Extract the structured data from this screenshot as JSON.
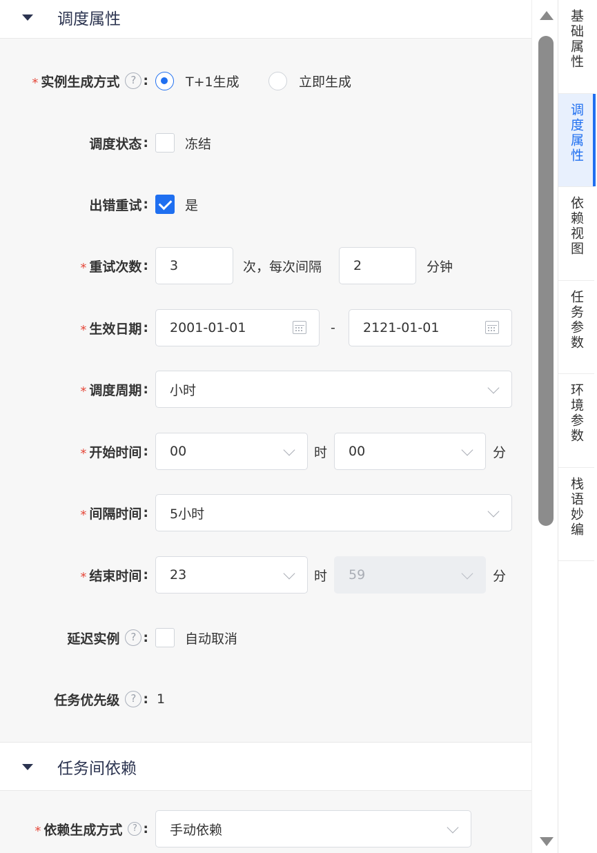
{
  "sections": {
    "schedule_title": "调度属性",
    "dependency_title": "任务间依赖"
  },
  "form": {
    "instance_generation": {
      "label": "实例生成方式",
      "options": [
        "T+1生成",
        "立即生成"
      ],
      "selected": "T+1生成"
    },
    "schedule_status": {
      "label": "调度状态",
      "option": "冻结",
      "checked": false
    },
    "retry_on_error": {
      "label": "出错重试",
      "option": "是",
      "checked": true
    },
    "retry_count": {
      "label": "重试次数",
      "count": "3",
      "middle_text": "次，每次间隔",
      "interval": "2",
      "unit": "分钟"
    },
    "effective_date": {
      "label": "生效日期",
      "start": "2001-01-01",
      "separator": "-",
      "end": "2121-01-01"
    },
    "schedule_period": {
      "label": "调度周期",
      "value": "小时"
    },
    "start_time": {
      "label": "开始时间",
      "hour": "00",
      "hour_unit": "时",
      "minute": "00",
      "minute_unit": "分"
    },
    "interval_time": {
      "label": "间隔时间",
      "value": "5小时"
    },
    "end_time": {
      "label": "结束时间",
      "hour": "23",
      "hour_unit": "时",
      "minute": "59",
      "minute_unit": "分"
    },
    "delay_instance": {
      "label": "延迟实例",
      "option": "自动取消",
      "checked": false
    },
    "task_priority": {
      "label": "任务优先级",
      "value": "1"
    },
    "dependency_generation": {
      "label": "依赖生成方式",
      "value": "手动依赖"
    }
  },
  "colon": ":",
  "help_glyph": "?",
  "required_mark": "*",
  "sidenav": [
    {
      "label": "基础属性",
      "active": false
    },
    {
      "label": "调度属性",
      "active": true
    },
    {
      "label": "依赖视图",
      "active": false
    },
    {
      "label": "任务参数",
      "active": false
    },
    {
      "label": "环境参数",
      "active": false
    },
    {
      "label": "栈语妙编",
      "active": false
    }
  ],
  "colors": {
    "accent": "#1f6ff0",
    "required": "#e5483a",
    "heading": "#2c3450"
  }
}
